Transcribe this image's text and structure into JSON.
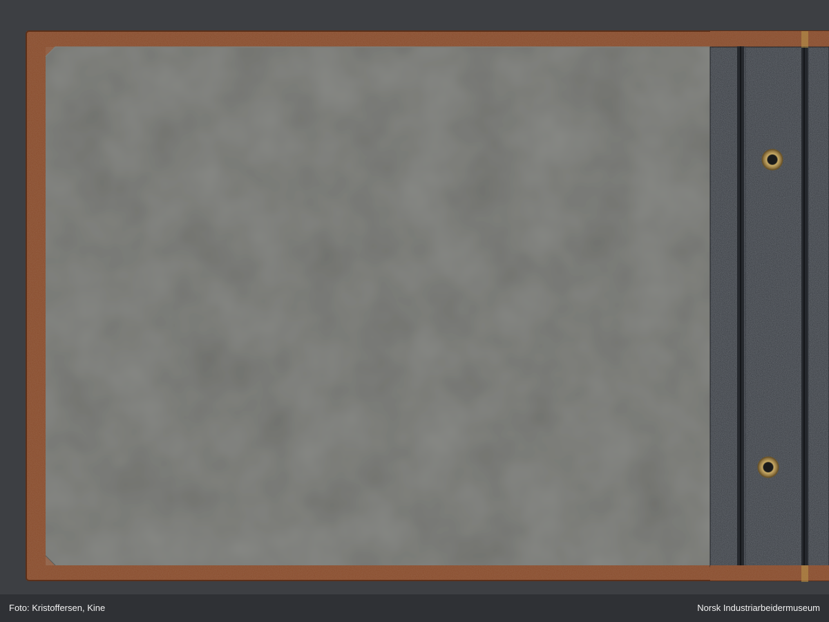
{
  "caption": {
    "photographer": "Foto: Kristoffersen, Kine",
    "institution": "Norsk Industriarbeidermuseum"
  },
  "colors": {
    "backdrop": "#3d3f43",
    "cover_leather": "#8a4b2a",
    "endpaper": "#6e6f6b",
    "spine_cloth": "#2c3036",
    "grommet": "#b89a5a",
    "caption_text": "#f2f2f2"
  },
  "objects": {
    "album_cover": "brown-leather-cover",
    "endpaper": "grey-endpaper",
    "spine": "black-spine-strip",
    "grommets": [
      "brass-grommet-upper",
      "brass-grommet-lower"
    ]
  }
}
